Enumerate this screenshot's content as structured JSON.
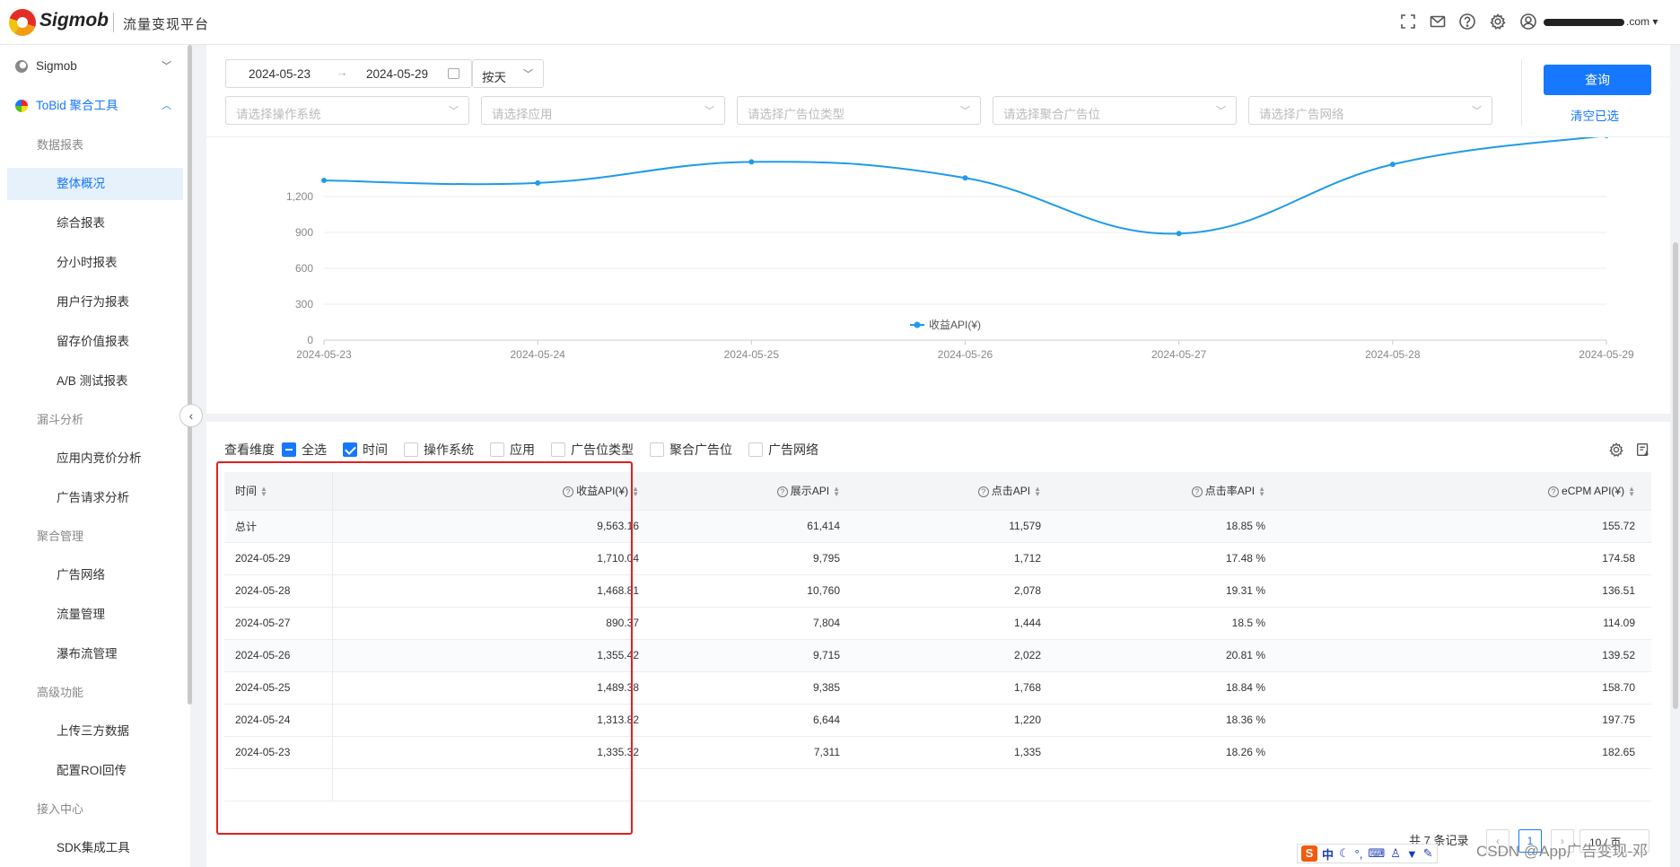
{
  "header": {
    "logo_text": "Sigmob",
    "platform_title": "流量变现平台",
    "account_suffix": ".com"
  },
  "sidebar": {
    "top_items": [
      {
        "label": "Sigmob",
        "chevron": "chevron-down-icon"
      },
      {
        "label": "ToBid 聚合工具",
        "chevron": "chevron-up-icon"
      }
    ],
    "groups": [
      {
        "label": "数据报表",
        "items": [
          "整体概况",
          "综合报表",
          "分小时报表",
          "用户行为报表",
          "留存价值报表",
          "A/B 测试报表"
        ]
      },
      {
        "label": "漏斗分析",
        "items": [
          "应用内竞价分析",
          "广告请求分析"
        ]
      },
      {
        "label": "聚合管理",
        "items": [
          "广告网络",
          "流量管理",
          "瀑布流管理"
        ]
      },
      {
        "label": "高级功能",
        "items": [
          "上传三方数据",
          "配置ROI回传"
        ]
      },
      {
        "label": "接入中心",
        "items": [
          "SDK集成工具"
        ]
      }
    ],
    "active_item": "整体概况"
  },
  "filters": {
    "start_date": "2024-05-23",
    "end_date": "2024-05-29",
    "granularity": "按天",
    "selects": [
      "请选择操作系统",
      "请选择应用",
      "请选择广告位类型",
      "请选择聚合广告位",
      "请选择广告网络"
    ],
    "query_label": "查询",
    "clear_label": "清空已选"
  },
  "chart_data": {
    "type": "line",
    "x": [
      "2024-05-23",
      "2024-05-24",
      "2024-05-25",
      "2024-05-26",
      "2024-05-27",
      "2024-05-28",
      "2024-05-29"
    ],
    "series": [
      {
        "name": "收益API(¥)",
        "values": [
          1335.32,
          1313.82,
          1489.38,
          1355.42,
          890.37,
          1468.81,
          1710.04
        ]
      }
    ],
    "y_ticks": [
      "0",
      "300",
      "600",
      "900",
      "1,200"
    ],
    "ylim": [
      0,
      1500
    ],
    "grid": true,
    "legend_placement": "bottom-center",
    "color": "#1e9bea"
  },
  "table": {
    "dims_label": "查看维度",
    "dims": [
      {
        "label": "全选",
        "state": "partial"
      },
      {
        "label": "时间",
        "state": "checked"
      },
      {
        "label": "操作系统",
        "state": "unchecked"
      },
      {
        "label": "应用",
        "state": "unchecked"
      },
      {
        "label": "广告位类型",
        "state": "unchecked"
      },
      {
        "label": "聚合广告位",
        "state": "unchecked"
      },
      {
        "label": "广告网络",
        "state": "unchecked"
      }
    ],
    "headers": [
      "时间",
      "收益API(¥)",
      "展示API",
      "点击API",
      "点击率API",
      "eCPM API(¥)"
    ],
    "rows": [
      [
        "总计",
        "9,563.16",
        "61,414",
        "11,579",
        "18.85 %",
        "155.72"
      ],
      [
        "2024-05-29",
        "1,710.04",
        "9,795",
        "1,712",
        "17.48 %",
        "174.58"
      ],
      [
        "2024-05-28",
        "1,468.81",
        "10,760",
        "2,078",
        "19.31 %",
        "136.51"
      ],
      [
        "2024-05-27",
        "890.37",
        "7,804",
        "1,444",
        "18.5 %",
        "114.09"
      ],
      [
        "2024-05-26",
        "1,355.42",
        "9,715",
        "2,022",
        "20.81 %",
        "139.52"
      ],
      [
        "2024-05-25",
        "1,489.38",
        "9,385",
        "1,768",
        "18.84 %",
        "158.70"
      ],
      [
        "2024-05-24",
        "1,313.82",
        "6,644",
        "1,220",
        "18.36 %",
        "197.75"
      ],
      [
        "2024-05-23",
        "1,335.32",
        "7,311",
        "1,335",
        "18.26 %",
        "182.65"
      ]
    ]
  },
  "pagination": {
    "total_text": "共 7 条记录",
    "current_page": "1",
    "page_size": "10 / 页"
  },
  "overlay": {
    "ime_text": "中",
    "watermark": "CSDN @App广告变现-邓"
  }
}
